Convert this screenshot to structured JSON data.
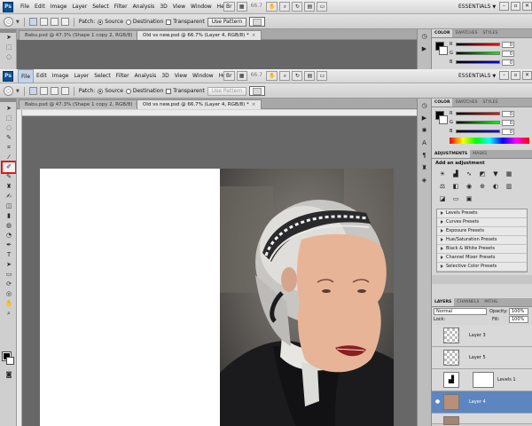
{
  "app": {
    "logo": "Ps",
    "menu": [
      "File",
      "Edit",
      "Image",
      "Layer",
      "Select",
      "Filter",
      "Analysis",
      "3D",
      "View",
      "Window",
      "Help"
    ],
    "zoom": "66.7",
    "workspace": "ESSENTIALS"
  },
  "options": {
    "tool_icon": "patch-tool-icon",
    "patch_label": "Patch:",
    "source_label": "Source",
    "destination_label": "Destination",
    "transparent_label": "Transparent",
    "use_pattern_label": "Use Pattern"
  },
  "top_window": {
    "tabs": [
      {
        "label": "Babu.psd @ 47.3% (Shape 1 copy 2, RGB/8)",
        "close": "×"
      },
      {
        "label": "Old vs new.psd @ 66.7% (Layer 4, RGB/8) *",
        "close": "×"
      }
    ]
  },
  "main_window": {
    "tabs": [
      {
        "label": "Babu.psd @ 47.3% (Shape 1 copy 2, RGB/8)",
        "close": "×"
      },
      {
        "label": "Old vs new.psd @ 66.7% (Layer 4, RGB/8) *",
        "close": "×"
      }
    ]
  },
  "color_panel": {
    "tabs": [
      "COLOR",
      "SWATCHES",
      "STYLES"
    ],
    "channels": [
      "R",
      "G",
      "B"
    ],
    "values": [
      "0",
      "0",
      "0"
    ]
  },
  "adjustments_panel": {
    "tabs": [
      "ADJUSTMENTS",
      "MASKS"
    ],
    "title": "Add an adjustment",
    "presets": [
      "Levels Presets",
      "Curves Presets",
      "Exposure Presets",
      "Hue/Saturation Presets",
      "Black & White Presets",
      "Channel Mixer Presets",
      "Selective Color Presets"
    ]
  },
  "layers_panel": {
    "tabs": [
      "LAYERS",
      "CHANNELS",
      "PATHS"
    ],
    "blend_mode": "Normal",
    "opacity_label": "Opacity:",
    "opacity": "100%",
    "lock_label": "Lock:",
    "fill_label": "Fill:",
    "fill": "100%",
    "layers": [
      {
        "name": "Layer 3"
      },
      {
        "name": "Layer 5"
      },
      {
        "name": "Levels 1"
      },
      {
        "name": "Layer 4"
      }
    ]
  },
  "colors": {
    "accent_highlight": "#e01818",
    "selected_layer": "#5d86c1",
    "face_patch": "#e7b497"
  }
}
